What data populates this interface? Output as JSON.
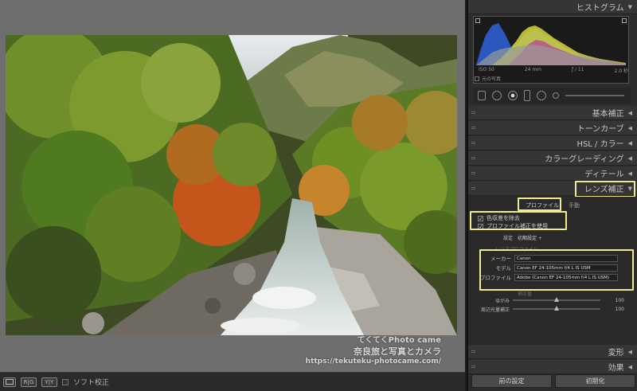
{
  "panels": {
    "histogram": {
      "title": "ヒストグラム",
      "iso": "ISO 50",
      "focal": "24 mm",
      "aperture": "ƒ / 11",
      "shutter": "2.0 秒",
      "original_photo": "元の写真"
    },
    "basic": "基本補正",
    "tone_curve": "トーンカーブ",
    "hsl": "HSL / カラー",
    "color_grading": "カラーグレーディング",
    "detail": "ディテール",
    "lens": "レンズ補正",
    "transform": "変形",
    "effects": "効果"
  },
  "lens": {
    "tab_profile": "プロファイル",
    "tab_manual": "手動",
    "remove_ca": "色収差を除去",
    "enable_profile": "プロファイル補正を使用",
    "setup_label": "設定",
    "setup_value": "初期設定 ÷",
    "lens_profile_header": "レンズプロファイル",
    "make_label": "メーカー",
    "make_value": "Canon",
    "model_label": "モデル",
    "model_value": "Canon EF 24-105mm f/4 L IS USM",
    "profile_label": "プロファイル",
    "profile_value": "Adobe (Canon EF 24-105mm f/4 L IS USM)",
    "amount_header": "補正量",
    "distortion_label": "ゆがみ",
    "distortion_value": "100",
    "vignetting_label": "周辺光量補正",
    "vignetting_value": "100"
  },
  "buttons": {
    "previous": "前の設定",
    "reset": "初期化"
  },
  "toolbar": {
    "soft_proof": "ソフト校正",
    "btn1": "R|G",
    "btn2": "Y|Y"
  },
  "watermark": {
    "line1": "てくてくPhoto came",
    "line2": "奈良旅と写真とカメラ",
    "line3": "https://tekuteku-photocame.com/"
  },
  "colors": {
    "highlight": "#f0eb90"
  }
}
